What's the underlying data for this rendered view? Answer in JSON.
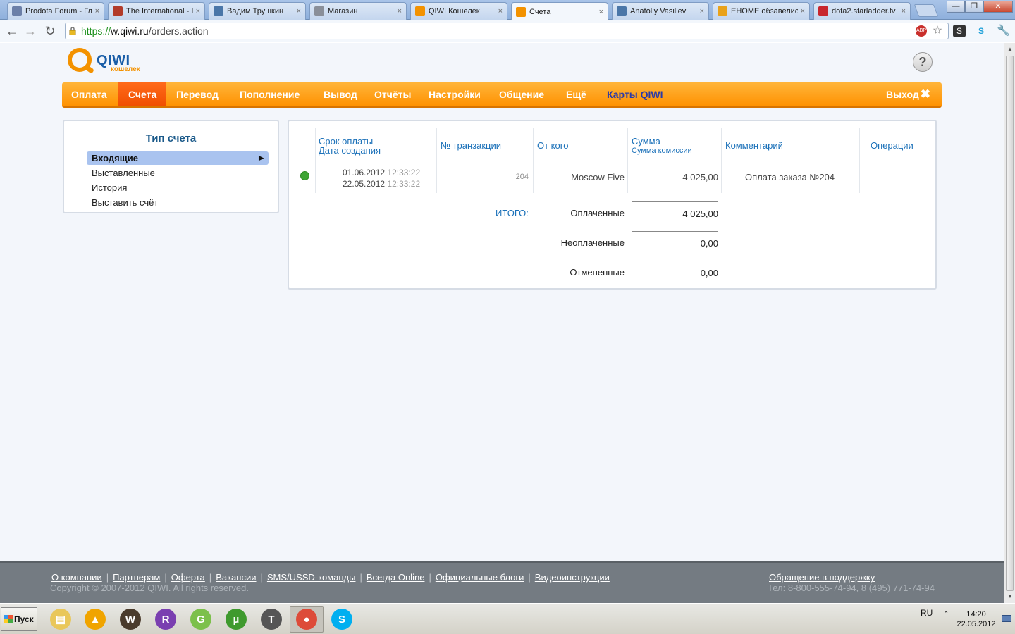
{
  "browser": {
    "tabs": [
      {
        "title": "Prodota Forum - Гл",
        "favicon": "prodota-icon",
        "color": "#6b7fa8"
      },
      {
        "title": "The International - I",
        "favicon": "dota2-icon",
        "color": "#b23b2a"
      },
      {
        "title": "Вадим Трушкин",
        "favicon": "vk-icon",
        "color": "#4a76a8"
      },
      {
        "title": "Магазин",
        "favicon": "globe-icon",
        "color": "#8a8f99"
      },
      {
        "title": "QIWI Кошелек",
        "favicon": "qiwi-icon",
        "color": "#f39200"
      },
      {
        "title": "Счета",
        "favicon": "qiwi-icon",
        "color": "#f39200",
        "active": true
      },
      {
        "title": "Anatoliy Vasiliev",
        "favicon": "vk-icon",
        "color": "#4a76a8"
      },
      {
        "title": "EHOME обзавелись",
        "favicon": "question-icon",
        "color": "#e9a21a"
      },
      {
        "title": "dota2.starladder.tv",
        "favicon": "starladder-icon",
        "color": "#c8262d"
      }
    ],
    "url_scheme": "https://",
    "url_host": "w.qiwi.ru",
    "url_path": "/orders.action",
    "window_controls": {
      "minimize": "—",
      "maximize": "❐",
      "close": "✕"
    }
  },
  "header": {
    "logo_word": "QIWI",
    "logo_sub": "кошелек",
    "help_label": "?"
  },
  "menu": {
    "items": [
      {
        "label": "Оплата"
      },
      {
        "label": "Счета",
        "active": true
      },
      {
        "label": "Перевод"
      },
      {
        "label": "Пополнение"
      },
      {
        "label": "Вывод"
      },
      {
        "label": "Отчёты"
      },
      {
        "label": "Настройки"
      },
      {
        "label": "Общение"
      },
      {
        "label": "Ещё"
      },
      {
        "label": "Карты QIWI"
      }
    ],
    "logout_label": "Выход"
  },
  "sidebar": {
    "title": "Тип счета",
    "items": [
      {
        "label": "Входящие",
        "selected": true
      },
      {
        "label": "Выставленные"
      },
      {
        "label": "История"
      },
      {
        "label": "Выставить счёт"
      }
    ]
  },
  "table": {
    "headers": {
      "due_date": "Срок оплаты",
      "created_date": "Дата создания",
      "transaction": "№ транзакции",
      "from": "От кого",
      "amount": "Сумма",
      "commission": "Сумма комиссии",
      "comment": "Комментарий",
      "operations": "Операции"
    },
    "rows": [
      {
        "status": "paid",
        "status_color": "#3fa535",
        "due_date": "01.06.2012",
        "due_time": "12:33:22",
        "created_date": "22.05.2012",
        "created_time": "12:33:22",
        "transaction": "204",
        "from": "Moscow Five",
        "amount": "4 025,00",
        "comment": "Оплата заказа №204"
      }
    ],
    "totals_label": "ИТОГО:",
    "totals": [
      {
        "label": "Оплаченные",
        "value": "4 025,00"
      },
      {
        "label": "Неоплаченные",
        "value": "0,00"
      },
      {
        "label": "Отмененные",
        "value": "0,00"
      }
    ]
  },
  "footer": {
    "links": [
      "О компании",
      "Партнерам",
      "Оферта",
      "Вакансии",
      "SMS/USSD-команды",
      "Всегда Online",
      "Официальные блоги",
      "Видеоинструкции"
    ],
    "copyright": "Copyright © 2007-2012 QIWI. All rights reserved.",
    "support_link": "Обращение в поддержку",
    "phone": "Тел: 8-800-555-74-94, 8 (495) 771-74-94"
  },
  "taskbar": {
    "start_label": "Пуск",
    "apps": [
      {
        "name": "explorer-icon",
        "color": "#e9c75a",
        "glyph": "▤"
      },
      {
        "name": "aimp-icon",
        "color": "#f0a400",
        "glyph": "▲"
      },
      {
        "name": "warcraft-icon",
        "color": "#4a3b2c",
        "glyph": "W"
      },
      {
        "name": "winrar-icon",
        "color": "#7a3fb0",
        "glyph": "R"
      },
      {
        "name": "garena-icon",
        "color": "#7cc04b",
        "glyph": "G"
      },
      {
        "name": "utorrent-icon",
        "color": "#3f9a2e",
        "glyph": "µ"
      },
      {
        "name": "world-of-tanks-icon",
        "color": "#555555",
        "glyph": "T"
      },
      {
        "name": "chrome-icon",
        "color": "#dd4b39",
        "glyph": "●",
        "pressed": true
      },
      {
        "name": "skype-icon",
        "color": "#00aff0",
        "glyph": "S"
      }
    ],
    "language": "RU",
    "time": "14:20",
    "date": "22.05.2012"
  }
}
